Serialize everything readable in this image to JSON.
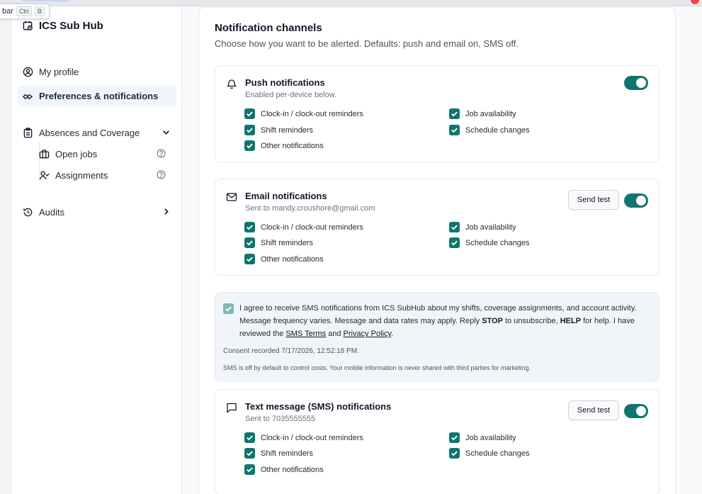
{
  "tooltip": {
    "text": "bar",
    "key1": "Ctrl",
    "key2": "B"
  },
  "sidebar": {
    "brand": "ICS Sub Hub",
    "my_profile": "My profile",
    "preferences": "Preferences & notifications",
    "absences": "Absences and Coverage",
    "open_jobs": "Open jobs",
    "assignments": "Assignments",
    "audits": "Audits"
  },
  "main": {
    "title": "Notification channels",
    "subtitle": "Choose how you want to be alerted. Defaults: push and email on, SMS off."
  },
  "push": {
    "title": "Push notifications",
    "subtitle": "Enabled per-device below.",
    "options": [
      "Clock-in / clock-out reminders",
      "Shift reminders",
      "Other notifications",
      "Job availability",
      "Schedule changes"
    ]
  },
  "email": {
    "title": "Email notifications",
    "subtitle": "Sent to mandy.croushore@gmail.com",
    "send_test": "Send test",
    "options": [
      "Clock-in / clock-out reminders",
      "Shift reminders",
      "Other notifications",
      "Job availability",
      "Schedule changes"
    ]
  },
  "consent": {
    "line1": "I agree to receive SMS notifications from ICS SubHub about my shifts, coverage assignments, and account activity.",
    "line2a": "Message frequency varies. Message and data rates may apply. Reply ",
    "stop": "STOP",
    "line2b": " to unsubscribe, ",
    "help": "HELP",
    "line2c": " for help. I have",
    "line3a": "reviewed the ",
    "sms_terms": "SMS Terms",
    "and": " and ",
    "privacy": "Privacy Policy",
    "period": ".",
    "recorded": "Consent recorded 7/17/2026, 12:52:18 PM.",
    "note": "SMS is off by default to control costs. Your mobile information is never shared with third parties for marketing."
  },
  "sms": {
    "title": "Text message (SMS) notifications",
    "subtitle": "Sent to 7035555555",
    "send_test": "Send test",
    "options": [
      "Clock-in / clock-out reminders",
      "Shift reminders",
      "Other notifications",
      "Job availability",
      "Schedule changes"
    ]
  },
  "colors": {
    "accent": "#0f766e",
    "consent_bg": "#f1f5f9"
  }
}
